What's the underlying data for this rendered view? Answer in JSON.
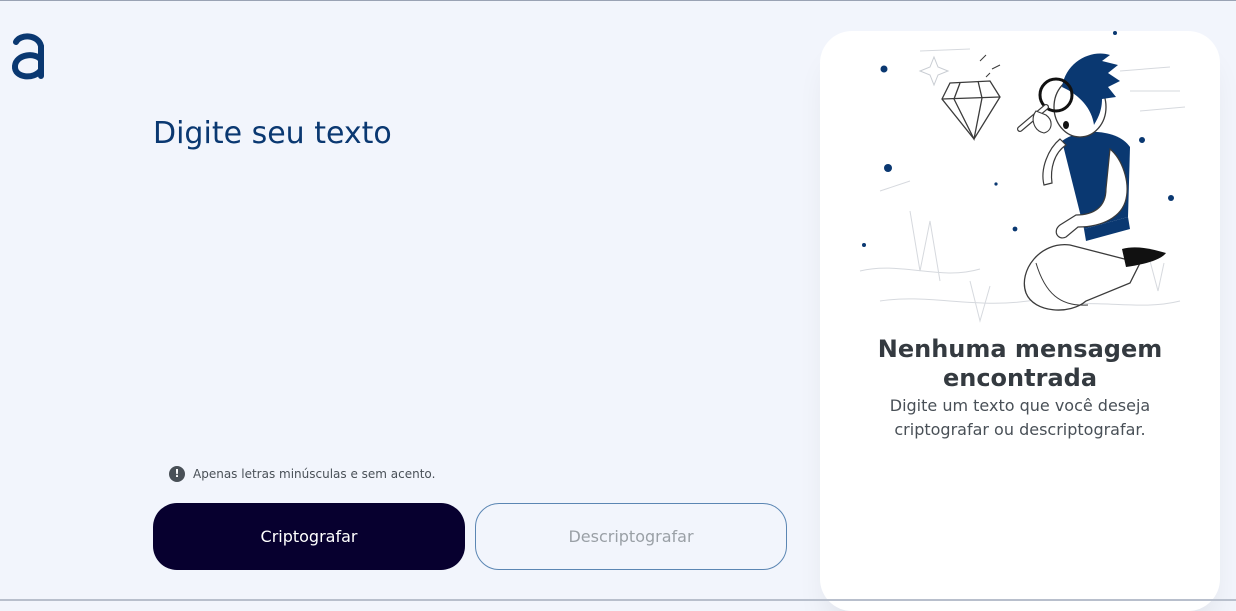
{
  "header": {
    "logo_icon": "alura-logo-icon",
    "brand_color": "#0a3871"
  },
  "input": {
    "placeholder": "Digite seu texto",
    "value": ""
  },
  "hint": {
    "icon": "exclamation-circle-icon",
    "text": "Apenas letras minúsculas e sem acento."
  },
  "buttons": {
    "encrypt_label": "Criptografar",
    "decrypt_label": "Descriptografar",
    "primary_color": "#07002f"
  },
  "output": {
    "illustration": "person-with-magnifying-glass-illustration",
    "title": "Nenhuma mensagem encontrada",
    "subtitle": "Digite um texto que você deseja criptografar ou descriptografar."
  }
}
